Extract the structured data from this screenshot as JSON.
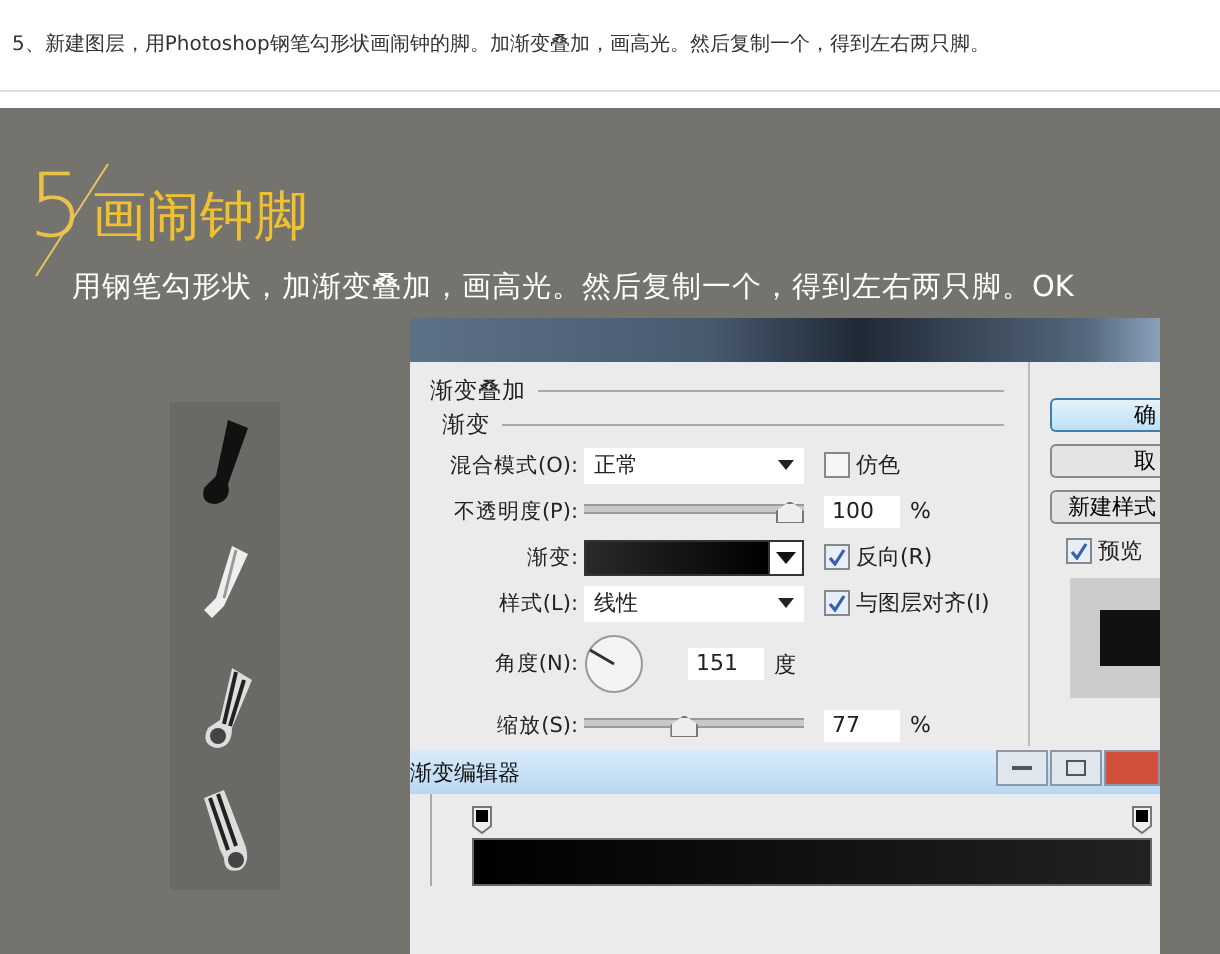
{
  "article": {
    "caption": "5、新建图层，用Photoshop钢笔勾形状画闹钟的脚。加渐变叠加，画高光。然后复制一个，得到左右两只脚。"
  },
  "banner": {
    "step": "5",
    "title": "画闹钟脚",
    "subtitle": "用钢笔勾形状，加渐变叠加，画高光。然后复制一个，得到左右两只脚。OK"
  },
  "dialog": {
    "section": "渐变叠加",
    "group": "渐变",
    "rows": [
      {
        "kind": "select",
        "label": "混合模式(O):",
        "value": "正常",
        "check": {
          "label": "仿色",
          "checked": false
        }
      },
      {
        "kind": "slider",
        "label": "不透明度(P):",
        "level": 1,
        "value": "100",
        "unit": "%"
      },
      {
        "kind": "gradient",
        "label": "渐变:",
        "check": {
          "label": "反向(R)",
          "checked": true
        }
      },
      {
        "kind": "select",
        "label": "样式(L):",
        "value": "线性",
        "check": {
          "label": "与图层对齐(I)",
          "checked": true
        }
      },
      {
        "kind": "angle",
        "label": "角度(N):",
        "value": "151",
        "unit": "度"
      },
      {
        "kind": "slider",
        "label": "缩放(S):",
        "level": 0.45,
        "value": "77",
        "unit": "%"
      }
    ],
    "buttons": [
      {
        "label": "确",
        "selected": true
      },
      {
        "label": "取",
        "selected": false
      },
      {
        "label": "新建样式",
        "selected": false
      }
    ],
    "preview": {
      "label": "预览",
      "checked": true
    }
  },
  "gradient_editor": {
    "title": "渐变编辑器"
  }
}
